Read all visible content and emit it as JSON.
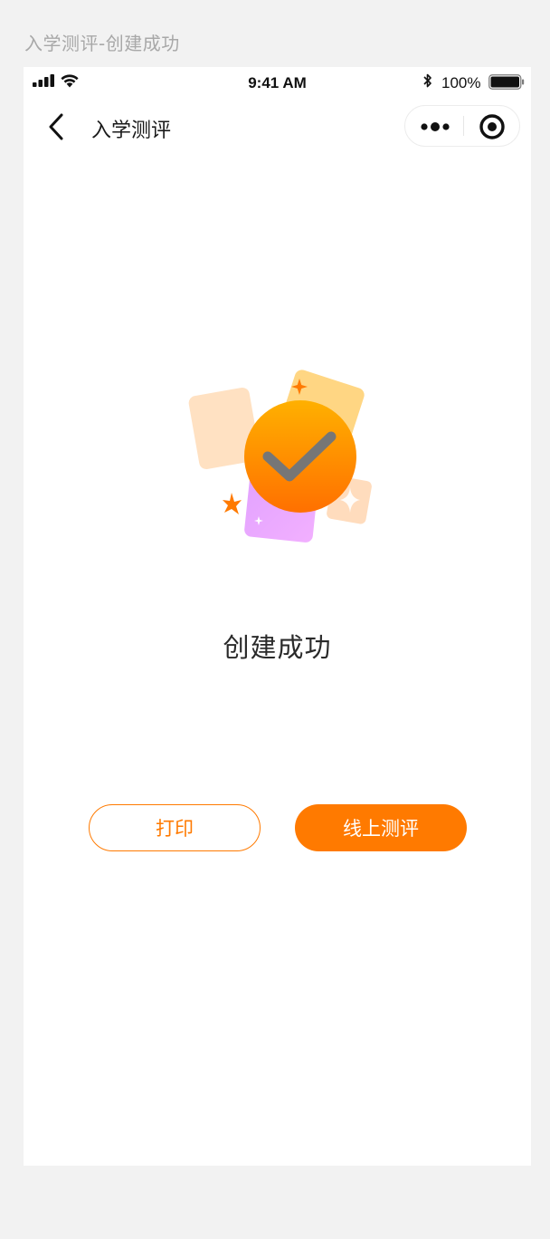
{
  "artboard": {
    "title": "入学测评-创建成功"
  },
  "status_bar": {
    "time": "9:41 AM",
    "battery_percent": "100%",
    "battery_level": 1.0
  },
  "nav": {
    "title": "入学测评",
    "icons": [
      "back-chevron-icon",
      "more-dots-icon",
      "close-circle-icon"
    ]
  },
  "result": {
    "title": "创建成功",
    "illustration_icon": "success-check-icon"
  },
  "actions": {
    "print_label": "打印",
    "online_label": "线上测评"
  },
  "colors": {
    "accent": "#ff7a00",
    "background": "#f2f2f2",
    "surface": "#ffffff"
  }
}
